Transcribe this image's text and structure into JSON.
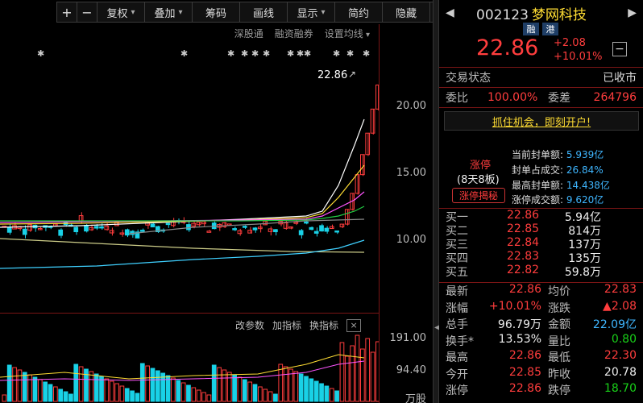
{
  "toolbar": {
    "plus": "+",
    "minus": "−",
    "fuquan": "复权",
    "diejia": "叠加",
    "chouma": "筹码",
    "huaxian": "画线",
    "xianshi": "显示",
    "jianyue": "简约",
    "yincang": "隐藏",
    "expand_icon": "expand-icon"
  },
  "subbar": {
    "shengutong": "深股通",
    "rongzi": "融资融券",
    "settings": "设置均线"
  },
  "price_axis": {
    "t20": "20.00",
    "t15": "15.00",
    "t10": "10.00"
  },
  "last_price_label": "22.86",
  "indicator_bar": {
    "params": "改参数",
    "add": "加指标",
    "switch": "换指标",
    "close": "×"
  },
  "volume_axis": {
    "t1": "191.00",
    "t2": "94.40",
    "t3": "万股"
  },
  "stock": {
    "code": "002123",
    "name": "梦网科技",
    "tag1": "融",
    "tag2": "港",
    "price": "22.86",
    "change": "+2.08",
    "change_pct": "+10.01%",
    "minus_box": "−"
  },
  "trade_status": {
    "label": "交易状态",
    "value": "已收市"
  },
  "weibi": {
    "l1": "委比",
    "v1": "100.00%",
    "l2": "委差",
    "v2": "264796"
  },
  "ad": "抓住机会，即刻开户!",
  "limit_up": {
    "title": "涨停",
    "sub": "(8天8板)",
    "btn": "涨停揭秘",
    "lines": [
      {
        "label": "当前封单额:",
        "value": "5.939亿"
      },
      {
        "label": "封单占成交:",
        "value": "26.84%"
      },
      {
        "label": "最高封单额:",
        "value": "14.438亿"
      },
      {
        "label": "涨停成交额:",
        "value": "9.620亿"
      }
    ]
  },
  "order_book": [
    {
      "label": "买一",
      "price": "22.86",
      "vol": "5.94亿"
    },
    {
      "label": "买二",
      "price": "22.85",
      "vol": "814万"
    },
    {
      "label": "买三",
      "price": "22.84",
      "vol": "137万"
    },
    {
      "label": "买四",
      "price": "22.83",
      "vol": "135万"
    },
    {
      "label": "买五",
      "price": "22.82",
      "vol": "59.8万"
    }
  ],
  "stats": [
    {
      "l1": "最新",
      "v1": "22.86",
      "c1": "red",
      "l2": "均价",
      "v2": "22.83",
      "c2": "red"
    },
    {
      "l1": "涨幅",
      "v1": "+10.01%",
      "c1": "red",
      "l2": "涨跌",
      "v2": "▲2.08",
      "c2": "red"
    },
    {
      "l1": "总手",
      "v1": "96.79万",
      "c1": "white",
      "l2": "金额",
      "v2": "22.09亿",
      "c2": "blue"
    },
    {
      "l1": "换手*",
      "v1": "13.53%",
      "c1": "white",
      "l2": "量比",
      "v2": "0.80",
      "c2": "green"
    },
    {
      "l1": "最高",
      "v1": "22.86",
      "c1": "red",
      "l2": "最低",
      "v2": "22.30",
      "c2": "red"
    },
    {
      "l1": "今开",
      "v1": "22.85",
      "c1": "red",
      "l2": "昨收",
      "v2": "20.78",
      "c2": "white"
    },
    {
      "l1": "涨停",
      "v1": "22.86",
      "c1": "red",
      "l2": "跌停",
      "v2": "18.70",
      "c2": "green"
    }
  ],
  "colors": {
    "up": "#ff3d3d",
    "down": "#19d1e6",
    "bg": "#000000",
    "divider": "#7a1515"
  }
}
